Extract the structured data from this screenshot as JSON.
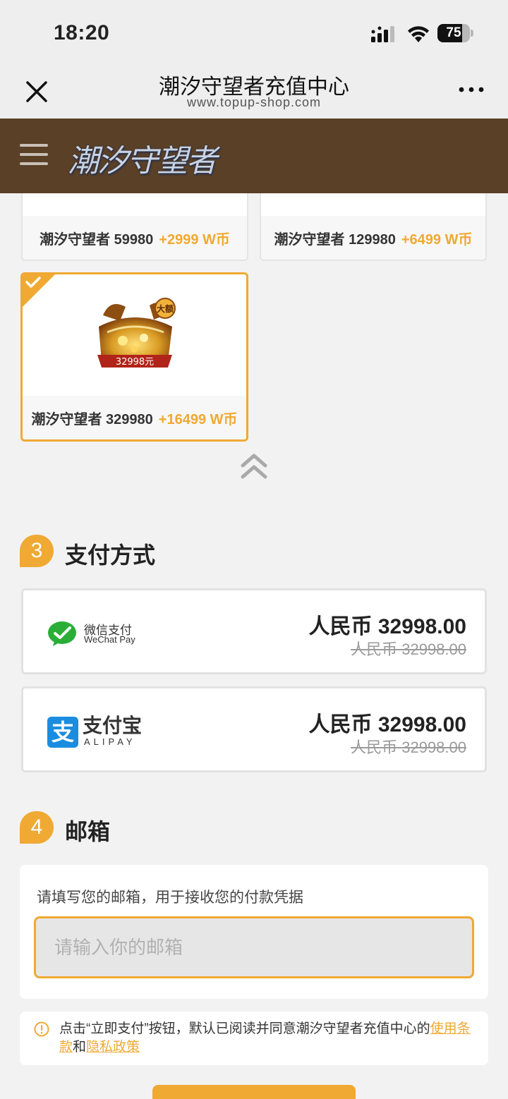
{
  "status_bar": {
    "time": "18:20",
    "battery": "75",
    "battery_level": 0.75
  },
  "nav": {
    "title": "潮汐守望者充值中心",
    "url": "www.topup-shop.com"
  },
  "brand": {
    "logo_text": "潮汐守望者"
  },
  "products": [
    {
      "name": "潮汐守望者 59980",
      "bonus": "+2999 W币"
    },
    {
      "name": "潮汐守望者 129980",
      "bonus": "+6499 W币"
    },
    {
      "name": "潮汐守望者 329980",
      "bonus": "+16499 W币",
      "image_badge": "大额",
      "image_price": "32998元",
      "selected": true
    }
  ],
  "payment": {
    "step": "3",
    "title": "支付方式",
    "methods": [
      {
        "name_cn": "微信支付",
        "name_en": "WeChat Pay",
        "price": "人民币 32998.00",
        "original_price": "人民币 32998.00"
      },
      {
        "name_cn": "支付宝",
        "name_en": "ALIPAY",
        "price": "人民币 32998.00",
        "original_price": "人民币 32998.00"
      }
    ]
  },
  "email": {
    "step": "4",
    "title": "邮箱",
    "hint": "请填写您的邮箱，用于接收您的付款凭据",
    "placeholder": "请输入你的邮箱",
    "value": ""
  },
  "notice": {
    "text_before": "点击“立即支付”按钮，默认已阅读并同意潮汐守望者充值中心的",
    "terms_link": "使用条款",
    "and": "和",
    "privacy_link": "隐私政策"
  },
  "colors": {
    "accent": "#f0a933",
    "brand_bar": "#5a4027",
    "wechat_green": "#2aae37",
    "alipay_blue": "#1a8de0"
  }
}
